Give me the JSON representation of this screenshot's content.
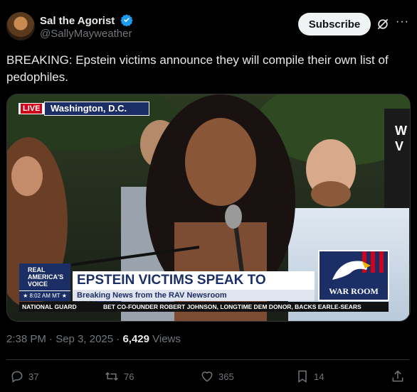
{
  "author": {
    "display_name": "Sal the Agorist",
    "handle": "@SallyMayweather"
  },
  "header": {
    "subscribe_label": "Subscribe",
    "more_label": "···"
  },
  "tweet": {
    "text": "BREAKING: Epstein victims announce they will compile their own list of pedophiles.",
    "time": "2:38 PM · Sep 3, 2025 · ",
    "views_count": "6,429",
    "views_label": " Views"
  },
  "media": {
    "live_badge": "LIVE",
    "location": "Washington, D.C.",
    "network_line1": "REAL",
    "network_line2": "AMERICA'S",
    "network_line3": "VOICE",
    "clock": "8:02 AM MT",
    "headline": "EPSTEIN VICTIMS SPEAK TO PRESS",
    "subheadline": "Breaking News from the RAV Newsroom",
    "show_logo": "WAR ROOM",
    "ticker_left": "NATIONAL GUARD",
    "ticker_right": "BET CO-FOUNDER ROBERT JOHNSON, LONGTIME DEM DONOR, BACKS EARLE-SEARS",
    "corner_text_1": "W",
    "corner_text_2": "V"
  },
  "actions": {
    "replies": "37",
    "reposts": "76",
    "likes": "365",
    "bookmarks": "14"
  },
  "colors": {
    "verified_blue": "#1d9bf0",
    "live_red": "#d0021b",
    "chyron_navy": "#1b2f66"
  }
}
